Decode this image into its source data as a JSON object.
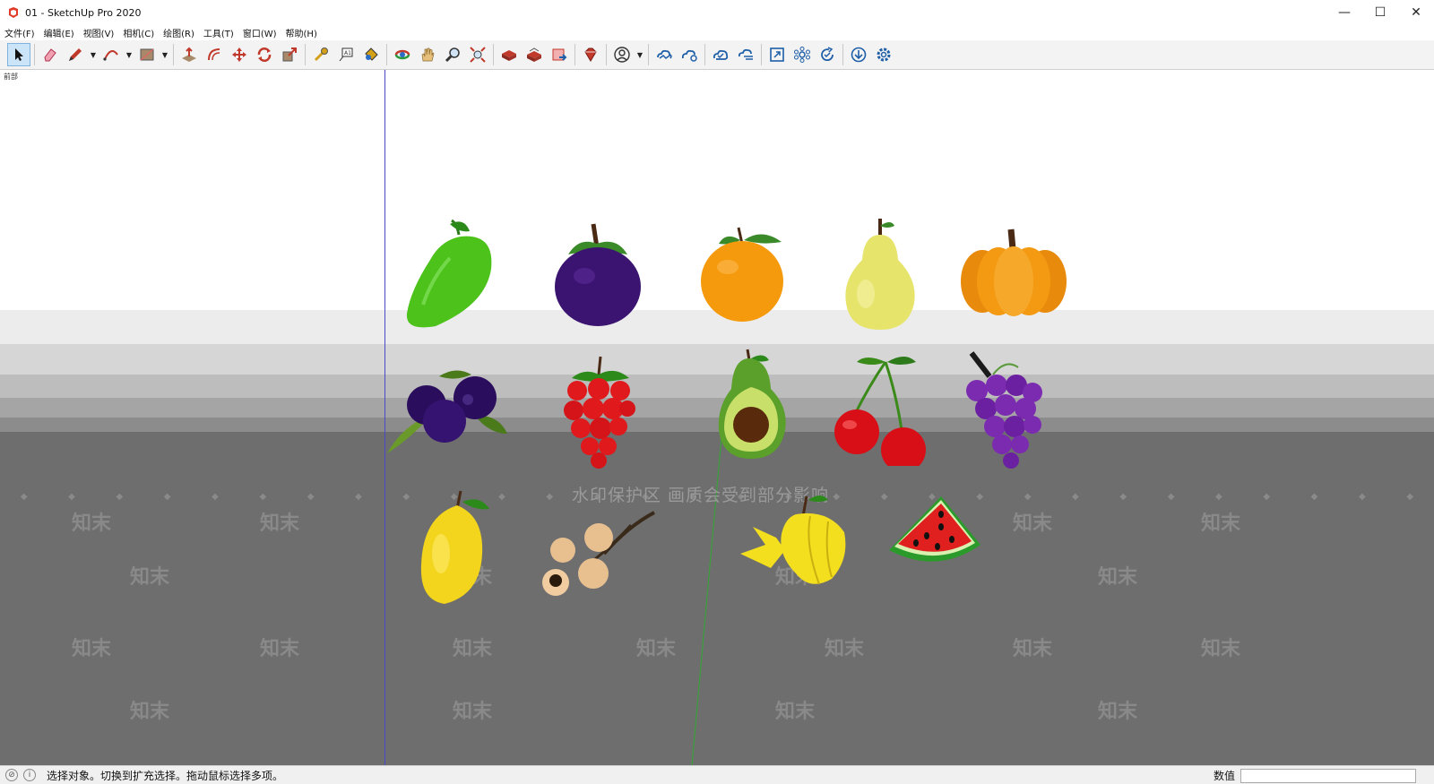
{
  "window": {
    "title": "01 - SketchUp Pro 2020",
    "controls": {
      "minimize": "—",
      "maximize": "☐",
      "close": "✕"
    }
  },
  "menu": {
    "items": [
      "文件(F)",
      "编辑(E)",
      "视图(V)",
      "相机(C)",
      "绘图(R)",
      "工具(T)",
      "窗口(W)",
      "帮助(H)"
    ]
  },
  "toolbar": {
    "tools": [
      {
        "name": "select-tool",
        "icon": "arrow-icon",
        "color": "#111111"
      },
      {
        "name": "eraser-tool",
        "icon": "eraser-icon",
        "color": "#e2556b"
      },
      {
        "name": "line-tool",
        "icon": "pencil-icon",
        "color": "#c0392b"
      },
      {
        "name": "arc-tool",
        "icon": "arc-icon",
        "color": "#c0392b"
      },
      {
        "name": "rectangle-tool",
        "icon": "rectangle-icon",
        "color": "#a88a6a"
      },
      {
        "name": "push-pull-tool",
        "icon": "push-pull-icon",
        "color": "#b0392b"
      },
      {
        "name": "offset-tool",
        "icon": "offset-icon",
        "color": "#c0392b"
      },
      {
        "name": "move-tool",
        "icon": "move-icon",
        "color": "#c0392b"
      },
      {
        "name": "rotate-tool",
        "icon": "rotate-icon",
        "color": "#c0392b"
      },
      {
        "name": "scale-tool",
        "icon": "scale-icon",
        "color": "#c0392b"
      },
      {
        "name": "tape-measure-tool",
        "icon": "tape-measure-icon",
        "color": "#d4a017"
      },
      {
        "name": "text-tool",
        "icon": "text-icon",
        "color": "#333333"
      },
      {
        "name": "paint-bucket-tool",
        "icon": "paint-bucket-icon",
        "color": "#d4a017"
      },
      {
        "name": "orbit-tool",
        "icon": "orbit-icon",
        "color": "#c0392b"
      },
      {
        "name": "pan-tool",
        "icon": "pan-hand-icon",
        "color": "#e6c07b"
      },
      {
        "name": "zoom-tool",
        "icon": "zoom-icon",
        "color": "#333333"
      },
      {
        "name": "zoom-extents-tool",
        "icon": "zoom-extents-icon",
        "color": "#c0392b"
      },
      {
        "name": "warehouse-tool",
        "icon": "warehouse-icon",
        "color": "#c0392b"
      },
      {
        "name": "extension-warehouse-tool",
        "icon": "extension-warehouse-icon",
        "color": "#c0392b"
      },
      {
        "name": "send-to-layout-tool",
        "icon": "layout-icon",
        "color": "#c0392b"
      },
      {
        "name": "ruby-tool",
        "icon": "ruby-icon",
        "color": "#c0392b"
      },
      {
        "name": "account-tool",
        "icon": "user-icon",
        "color": "#333333"
      },
      {
        "name": "trimble-connect-tool",
        "icon": "cloud-icon",
        "color": "#1f5fa8"
      },
      {
        "name": "cloud-share-tool",
        "icon": "cloud-share-icon",
        "color": "#1f5fa8"
      },
      {
        "name": "cloud-sync-tool",
        "icon": "cloud-check-icon",
        "color": "#1f5fa8"
      },
      {
        "name": "cloud-upload-tool",
        "icon": "cloud-lines-icon",
        "color": "#1f5fa8"
      },
      {
        "name": "resize-tool",
        "icon": "resize-icon",
        "color": "#1f5fa8"
      },
      {
        "name": "network-tool",
        "icon": "network-icon",
        "color": "#1f5fa8"
      },
      {
        "name": "refresh-tool",
        "icon": "refresh-check-icon",
        "color": "#1f5fa8"
      },
      {
        "name": "download-tool",
        "icon": "download-icon",
        "color": "#1f5fa8"
      },
      {
        "name": "settings-tool",
        "icon": "gear-icon",
        "color": "#1f5fa8"
      }
    ]
  },
  "viewport": {
    "scene_label": "前部",
    "watermark_text": "水印保护区   画质会受到部分影响",
    "watermark_brand": "知末",
    "sky_color": "#ffffff",
    "ground_color": "#6e6e6e"
  },
  "fruits": [
    {
      "name": "mango",
      "color": "#4cc21a"
    },
    {
      "name": "mangosteen",
      "color": "#3a1470"
    },
    {
      "name": "orange",
      "color": "#f59a0c"
    },
    {
      "name": "pear",
      "color": "#e6e46a"
    },
    {
      "name": "pumpkin",
      "color": "#f39a12"
    },
    {
      "name": "blueberries",
      "color": "#2a0d5c"
    },
    {
      "name": "raspberry",
      "color": "#e0191c"
    },
    {
      "name": "avocado",
      "color": "#6ab23a"
    },
    {
      "name": "cherries",
      "color": "#d80f17"
    },
    {
      "name": "grapes",
      "color": "#7b2bb0"
    },
    {
      "name": "lemon",
      "color": "#f2d51c"
    },
    {
      "name": "longan",
      "color": "#e8c090"
    },
    {
      "name": "starfruit",
      "color": "#f4df1e"
    },
    {
      "name": "watermelon",
      "color": "#e01f1f"
    }
  ],
  "status": {
    "message": "选择对象。切换到扩充选择。拖动鼠标选择多项。",
    "measure_label": "数值",
    "measure_value": ""
  }
}
